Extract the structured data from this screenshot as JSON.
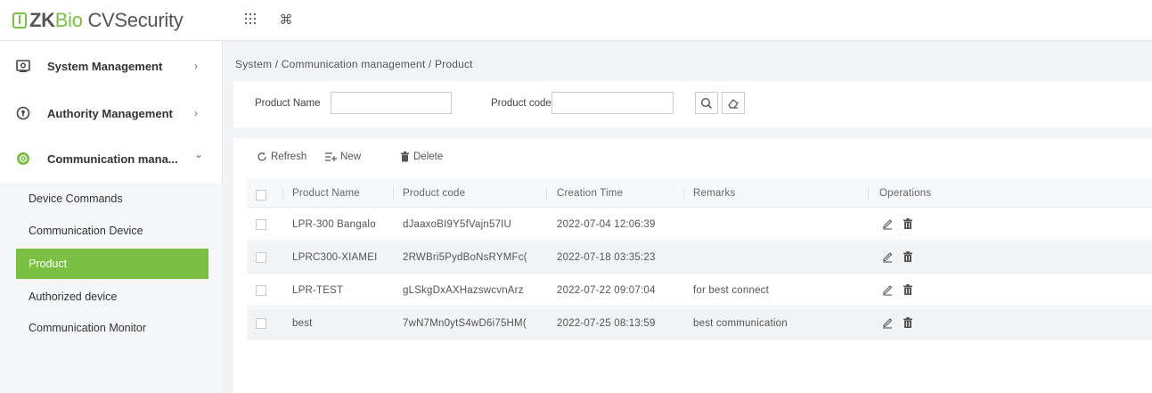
{
  "header": {
    "logo": {
      "brand_prefix": "ZK",
      "brand_bio": "Bio",
      "brand_rest": " CVSecurity"
    },
    "icons": [
      "apps-grid-icon",
      "command-icon"
    ]
  },
  "sidebar": {
    "items": [
      {
        "label": "System Management",
        "icon": "system-gear-icon",
        "chevron": "›"
      },
      {
        "label": "Authority Management",
        "icon": "authority-shield-icon",
        "chevron": "›"
      },
      {
        "label": "Communication mana...",
        "icon": "communication-globe-icon",
        "chevron": "⌄"
      }
    ],
    "submenu": [
      {
        "label": "Device Commands"
      },
      {
        "label": "Communication Device"
      },
      {
        "label": "Product",
        "active": true
      },
      {
        "label": "Authorized device"
      },
      {
        "label": "Communication Monitor"
      }
    ]
  },
  "breadcrumb": "System / Communication management / Product",
  "filters": {
    "product_name_label": "Product Name",
    "product_name_value": "",
    "product_code_label": "Product code",
    "product_code_value": ""
  },
  "toolbar": {
    "refresh": "Refresh",
    "new": "New",
    "delete": "Delete"
  },
  "table": {
    "columns": [
      "Product Name",
      "Product code",
      "Creation Time",
      "Remarks",
      "Operations"
    ],
    "rows": [
      {
        "name": "LPR-300 Bangalo",
        "code": "dJaaxoBI9Y5fVajn57IU",
        "time": "2022-07-04 12:06:39",
        "remarks": ""
      },
      {
        "name": "LPRC300-XIAMEI",
        "code": "2RWBri5PydBoNsRYMFc(",
        "time": "2022-07-18 03:35:23",
        "remarks": ""
      },
      {
        "name": "LPR-TEST",
        "code": "gLSkgDxAXHazswcvnArz",
        "time": "2022-07-22 09:07:04",
        "remarks": "for best connect"
      },
      {
        "name": "best",
        "code": "7wN7Mn0ytS4wD6i75HM(",
        "time": "2022-07-25 08:13:59",
        "remarks": "best communication"
      }
    ]
  },
  "colors": {
    "accent": "#7ac143",
    "panel_bg": "#f1f3f6"
  }
}
